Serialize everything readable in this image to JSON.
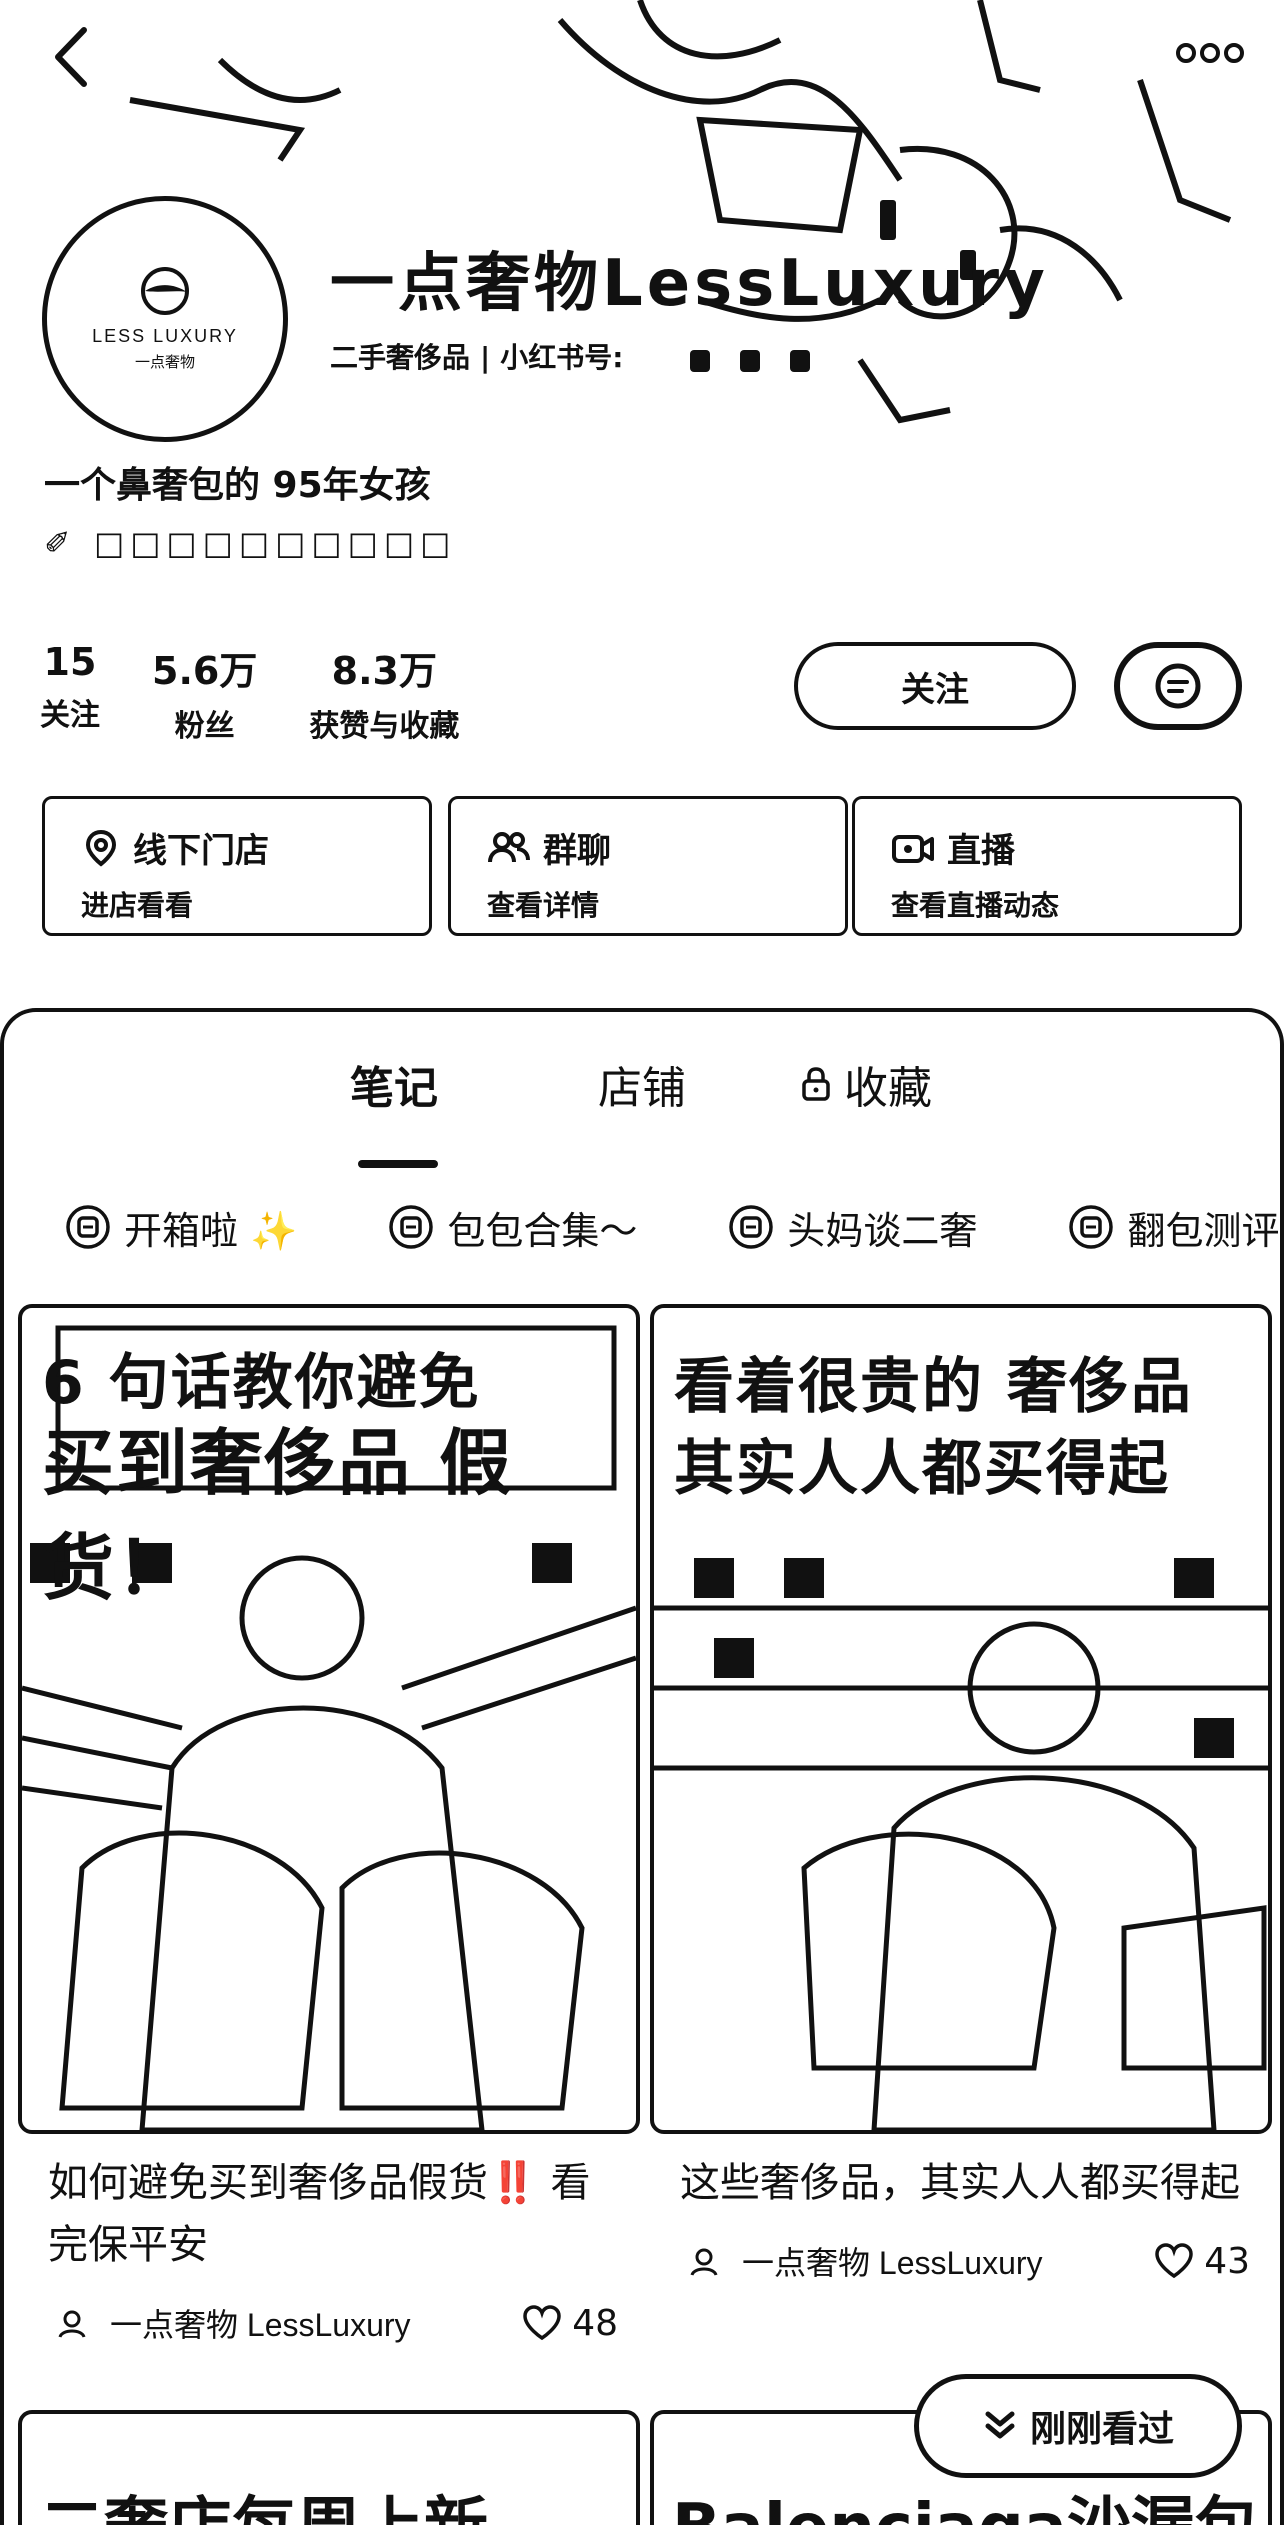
{
  "header": {
    "back_icon": "chevron-left-icon",
    "more_icon": "more-dots-icon"
  },
  "profile": {
    "avatar_brand": "LESS LUXURY",
    "avatar_brand_cn": "一点奢物",
    "nickname": "一点奢物LessLuxury",
    "category": "二手奢侈品",
    "id_label": "小红书号:",
    "bio_line1": "一个鼻奢包的 95年女孩",
    "bio_line2": "✐ □□□□□□□□□□",
    "stats": [
      {
        "num": "15",
        "label": "关注"
      },
      {
        "num": "5.6万",
        "label": "粉丝"
      },
      {
        "num": "8.3万",
        "label": "获赞与收藏"
      }
    ],
    "follow_label": "关注",
    "chat_icon": "chat-bubble-icon"
  },
  "services": [
    {
      "icon": "location-pin-icon",
      "title": "线下门店",
      "subtitle": "进店看看"
    },
    {
      "icon": "group-chat-icon",
      "title": "群聊",
      "subtitle": "查看详情"
    },
    {
      "icon": "live-camera-icon",
      "title": "直播",
      "subtitle": "查看直播动态"
    }
  ],
  "tabs": [
    {
      "label": "笔记",
      "active": true
    },
    {
      "label": "店铺",
      "active": false
    },
    {
      "label": "收藏",
      "active": false,
      "icon": "lock-icon"
    }
  ],
  "albums": [
    {
      "label": "开箱啦 ✨"
    },
    {
      "label": "包包合集～"
    },
    {
      "label": "头妈谈二奢"
    },
    {
      "label": "翻包测评"
    }
  ],
  "notes": [
    {
      "cover_line1": "6 句话教你避免",
      "cover_line2": "买到奢侈品 假货！",
      "title": "如何避免买到奢侈品假货‼️ 看完保平安",
      "author": "一点奢物 LessLuxury",
      "likes": "48"
    },
    {
      "cover_line1": "看着很贵的 奢侈品",
      "cover_line2": "其实人人都买得起",
      "title": "这些奢侈品，其实人人都买得起",
      "author": "一点奢物 LessLuxury",
      "likes": "43"
    }
  ],
  "next_notes": [
    {
      "cover_text": "二奢店每周上新"
    },
    {
      "cover_text": "Balenciaga沙漏包"
    }
  ],
  "recent_label": "刚刚看过",
  "colors": {
    "ink": "#111111",
    "background": "#ffffff"
  }
}
